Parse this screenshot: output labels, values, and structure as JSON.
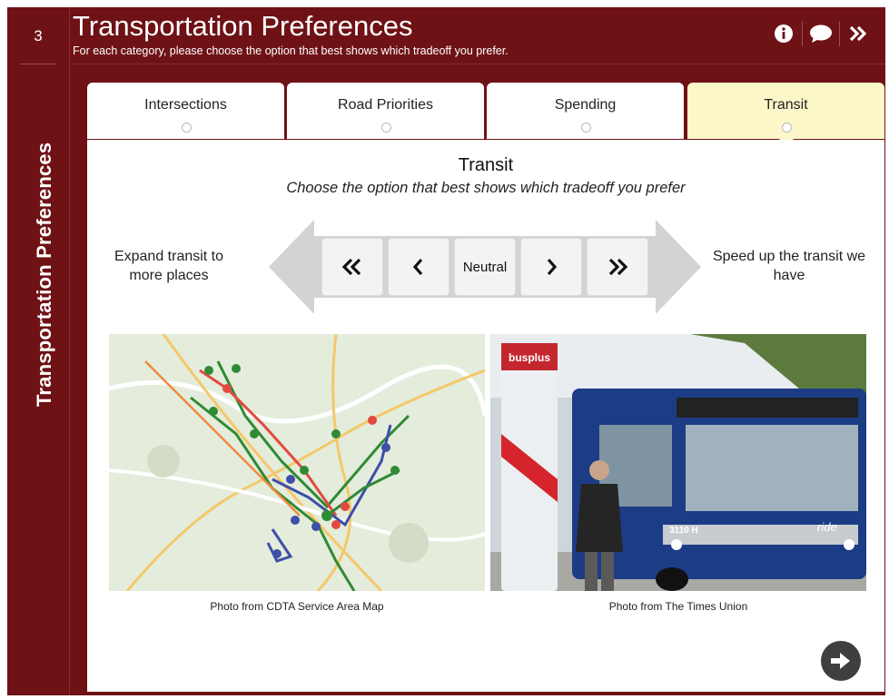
{
  "step": {
    "number": "3"
  },
  "sidebar": {
    "title": "Transportation Preferences"
  },
  "header": {
    "title": "Transportation Preferences",
    "subtitle": "For each category, please choose the option that best shows which tradeoff you prefer."
  },
  "tabs": [
    {
      "label": "Intersections",
      "active": false
    },
    {
      "label": "Road Priorities",
      "active": false
    },
    {
      "label": "Spending",
      "active": false
    },
    {
      "label": "Transit",
      "active": true
    }
  ],
  "question": {
    "title": "Transit",
    "subtitle": "Choose the option that best shows which tradeoff you prefer",
    "left_option": "Expand transit to more places",
    "right_option": "Speed up the transit we have"
  },
  "scale": {
    "buttons": [
      {
        "id": "strong-left",
        "icon": "double-chevron-left-icon"
      },
      {
        "id": "left",
        "icon": "chevron-left-icon"
      },
      {
        "id": "neutral",
        "label": "Neutral"
      },
      {
        "id": "right",
        "icon": "chevron-right-icon"
      },
      {
        "id": "strong-right",
        "icon": "double-chevron-right-icon"
      }
    ]
  },
  "images": [
    {
      "alt": "transit-map",
      "caption": "Photo from CDTA Service Area Map"
    },
    {
      "alt": "bus-photo",
      "caption": "Photo from The Times Union"
    }
  ],
  "bus_photo_text": {
    "pole_brand": "busplus",
    "bus_number": "3110 H",
    "bus_brand": "ride"
  },
  "colors": {
    "maroon": "#6e1216",
    "active_tab": "#fbf7c8",
    "scale_arrow": "#d3d3d3"
  },
  "icons": {
    "info": "info-icon",
    "chat": "chat-bubble-icon",
    "skip": "double-chevron-right-icon",
    "next": "arrow-right-icon"
  }
}
